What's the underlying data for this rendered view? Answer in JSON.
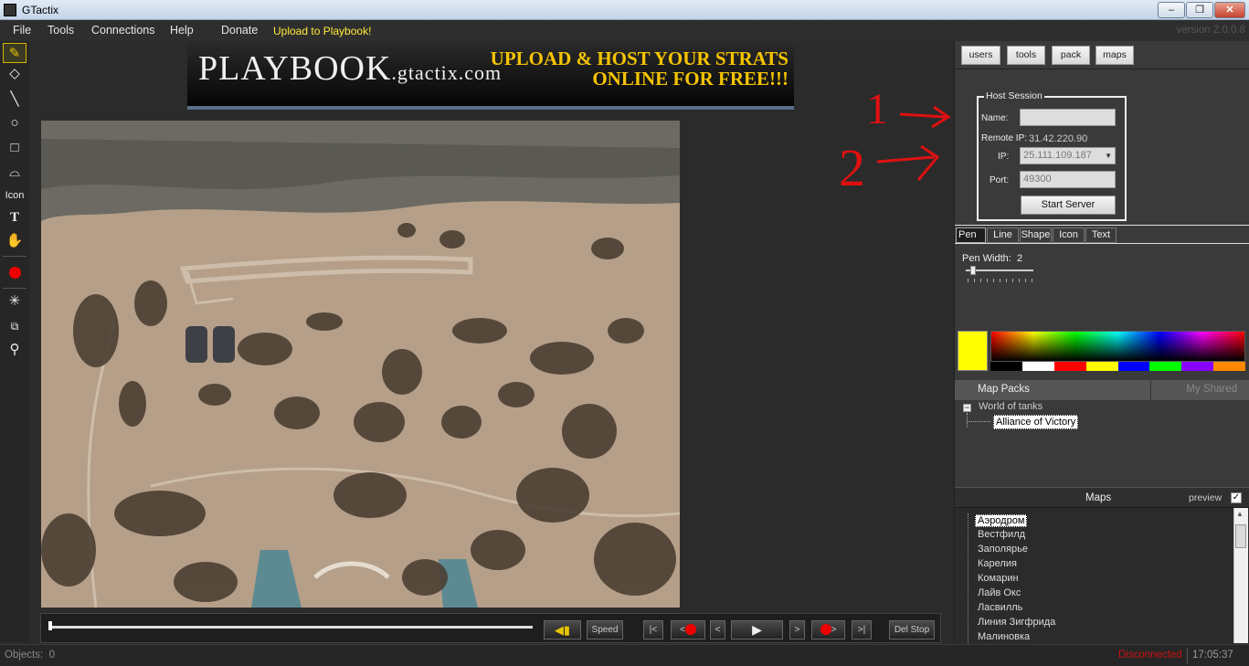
{
  "window": {
    "title": "GTactix",
    "min": "–",
    "max": "❐",
    "close": "✕"
  },
  "menu": {
    "items": [
      "File",
      "Tools",
      "Connections",
      "Help",
      "Donate"
    ],
    "upload": "Upload to Playbook!",
    "version": "version 2.0.0.8"
  },
  "toolbar": {
    "icon_label": "Icon"
  },
  "banner": {
    "brand_main": "PLAYBOOK",
    "brand_domain": ".gtactix.com",
    "slogan_line1": "UPLOAD & HOST YOUR STRATS",
    "slogan_line2": "ONLINE FOR FREE!!!"
  },
  "annotations": {
    "one": "1",
    "two": "2"
  },
  "playback": {
    "speed": "Speed",
    "first": "|<",
    "rec_back": "<",
    "step_back": "<",
    "step_fwd": ">",
    "rec_fwd": ">",
    "last": ">|",
    "del_stop": "Del Stop"
  },
  "right_tabs": [
    "users",
    "tools",
    "pack",
    "maps"
  ],
  "host": {
    "legend": "Host Session",
    "name_label": "Name:",
    "name_value": "",
    "remote_label": "Remote IP:",
    "remote_value": "31.42.220.90",
    "ip_label": "IP:",
    "ip_value": "25.111.109.187",
    "port_label": "Port:",
    "port_value": "49300",
    "start": "Start Server"
  },
  "tool_tabs": [
    "Pen",
    "Line",
    "Shape",
    "Icon",
    "Text"
  ],
  "pen": {
    "width_label": "Pen Width:",
    "width_value": "2"
  },
  "colors": {
    "current": "#ffff00",
    "palette": [
      "#000000",
      "#ffffff",
      "#ff0000",
      "#ffff00",
      "#0000ff",
      "#00ff00",
      "#8800ff",
      "#ff8800"
    ]
  },
  "map_packs": {
    "title": "Map Packs",
    "shared": "My Shared",
    "root": "World of tanks",
    "child": "Alliance of Victory"
  },
  "maps": {
    "title": "Maps",
    "preview": "preview",
    "preview_checked": "✓",
    "items": [
      "Аэродром",
      "Вестфилд",
      "Заполярье",
      "Карелия",
      "Комарин",
      "Лайв Окс",
      "Ласвилль",
      "Линия Зигфрида",
      "Малиновка"
    ]
  },
  "status": {
    "objects_label": "Objects:",
    "objects_count": "0",
    "connection": "Disconnected",
    "time": "17:05:37"
  }
}
